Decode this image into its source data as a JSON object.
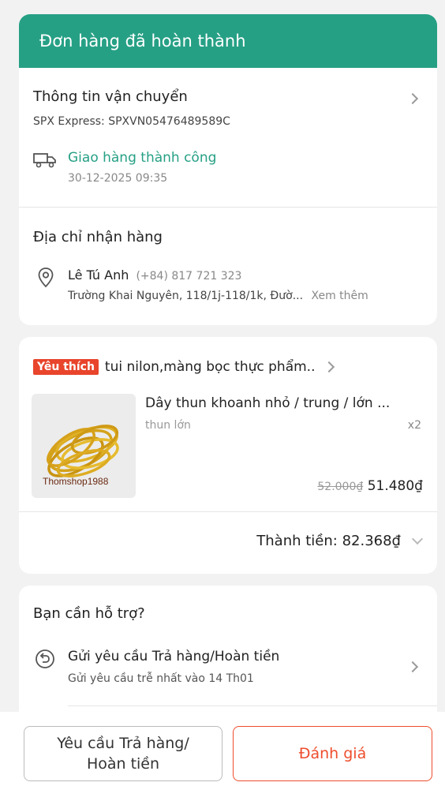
{
  "header": {
    "title": "Đơn hàng đã hoàn thành"
  },
  "shipping": {
    "title": "Thông tin vận chuyển",
    "carrier": "SPX Express: SPXVN05476489589C",
    "status": "Giao hàng thành công",
    "time": "30-12-2025 09:35"
  },
  "address": {
    "title": "Địa chỉ nhận hàng",
    "name": "Lê Tú Anh",
    "phone": "(+84) 817 721 323",
    "line": "Trường Khai Nguyên, 118/1j-118/1k, Đườ...",
    "more": "Xem thêm"
  },
  "shop": {
    "badge": "Yêu thích",
    "name": "tui nilon,màng bọc thực phẩm..",
    "product": {
      "name": "Dây thun khoanh nhỏ / trung / lớn ...",
      "variant": "thun lớn",
      "qty": "x2",
      "watermark": "Thomshop1988",
      "old_price": "52.000₫",
      "price": "51.480₫"
    },
    "total_label": "Thành tiền: 82.368₫"
  },
  "support": {
    "title": "Bạn cần hỗ trợ?",
    "item_title": "Gửi yêu cầu Trả hàng/Hoàn tiền",
    "item_sub": "Gửi yêu cầu trễ nhất vào 14 Th01"
  },
  "actions": {
    "return_line1": "Yêu cầu Trả hàng/",
    "return_line2": "Hoàn tiền",
    "rate": "Đánh giá"
  },
  "colors": {
    "accent": "#26a085",
    "primary": "#ee4d2d",
    "badge": "#e8452c"
  }
}
